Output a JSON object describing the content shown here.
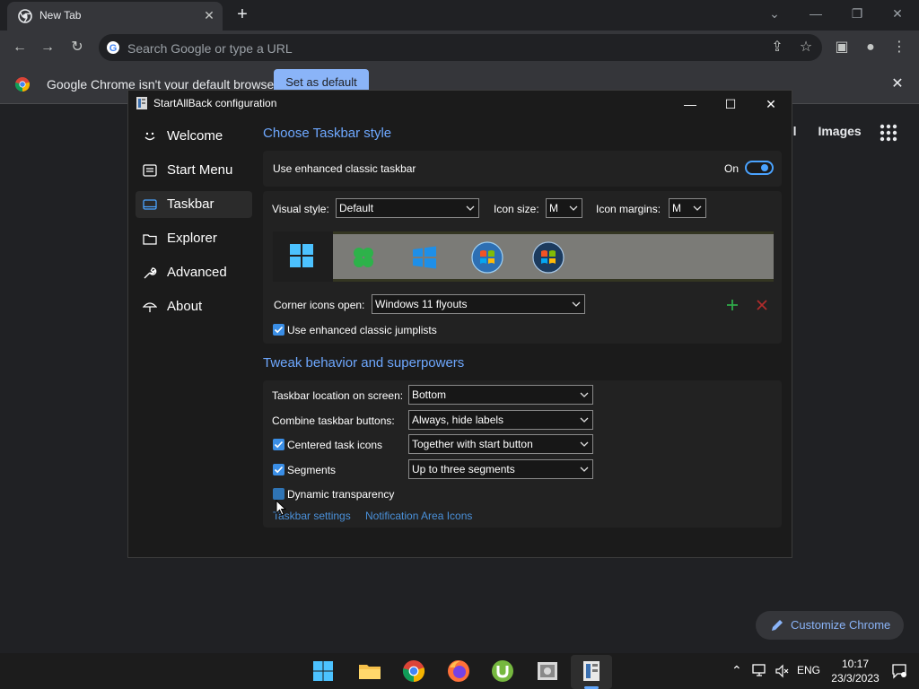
{
  "browser": {
    "tab_title": "New Tab",
    "omnibox_placeholder": "Search Google or type a URL",
    "infobar_text": "Google Chrome isn't your default browser",
    "infobar_button": "Set as default",
    "ntp_links": [
      "ail",
      "Images"
    ],
    "customize_label": "Customize Chrome"
  },
  "dialog": {
    "title": "StartAllBack configuration",
    "nav": [
      {
        "label": "Welcome",
        "icon": "smile-icon"
      },
      {
        "label": "Start Menu",
        "icon": "start-menu-icon"
      },
      {
        "label": "Taskbar",
        "icon": "taskbar-icon",
        "active": true
      },
      {
        "label": "Explorer",
        "icon": "explorer-icon"
      },
      {
        "label": "Advanced",
        "icon": "wrench-icon"
      },
      {
        "label": "About",
        "icon": "umbrella-icon"
      }
    ],
    "style_section": {
      "heading": "Choose Taskbar style",
      "enhanced_label": "Use enhanced classic taskbar",
      "enhanced_state": "On",
      "visual_style_label": "Visual style:",
      "visual_style_value": "Default",
      "icon_size_label": "Icon size:",
      "icon_size_value": "M",
      "icon_margins_label": "Icon margins:",
      "icon_margins_value": "M",
      "corner_label": "Corner icons open:",
      "corner_value": "Windows 11 flyouts",
      "jumplists_label": "Use enhanced classic jumplists"
    },
    "behavior_section": {
      "heading": "Tweak behavior and superpowers",
      "location_label": "Taskbar location on screen:",
      "location_value": "Bottom",
      "combine_label": "Combine taskbar buttons:",
      "combine_value": "Always, hide labels",
      "centered_label": "Centered task icons",
      "centered_value": "Together with start button",
      "segments_label": "Segments",
      "segments_value": "Up to three segments",
      "dynamic_label": "Dynamic transparency",
      "link_settings": "Taskbar settings",
      "link_notification": "Notification Area Icons"
    }
  },
  "tray": {
    "language": "ENG",
    "time": "10:17",
    "date": "23/3/2023"
  },
  "colors": {
    "accent": "#6ea8ff",
    "toggle": "#4aa3ff",
    "checkbox": "#3a8ee6",
    "chrome_blue": "#8ab4f8"
  }
}
